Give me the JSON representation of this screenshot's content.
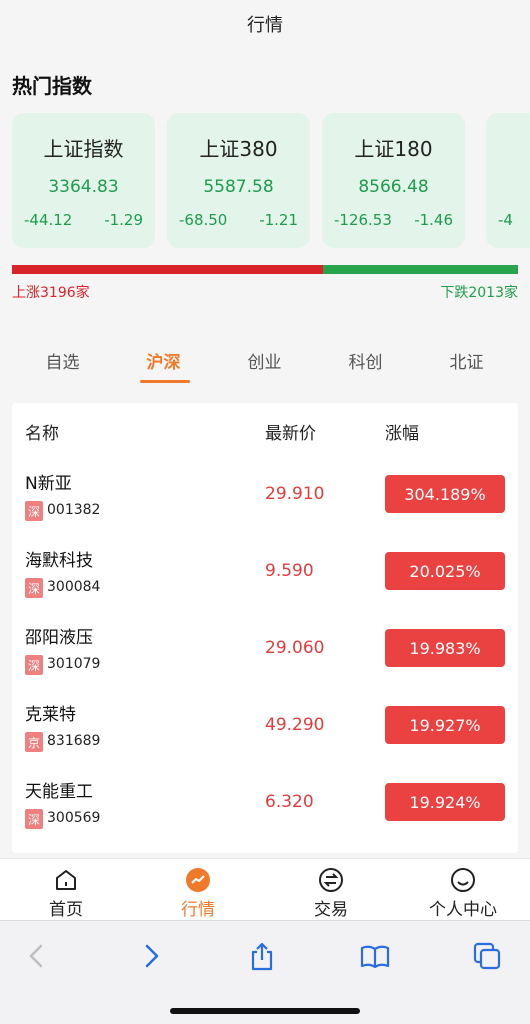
{
  "header": {
    "title": "行情"
  },
  "hot_indices": {
    "title": "热门指数",
    "items": [
      {
        "name": "上证指数",
        "price": "3364.83",
        "change": "-44.12",
        "change_pct": "-1.29"
      },
      {
        "name": "上证380",
        "price": "5587.58",
        "change": "-68.50",
        "change_pct": "-1.21"
      },
      {
        "name": "上证180",
        "price": "8566.48",
        "change": "-126.53",
        "change_pct": "-1.46"
      },
      {
        "name": "",
        "price": "",
        "change": "-4",
        "change_pct": ""
      }
    ]
  },
  "breadth": {
    "up_label": "上涨3196家",
    "down_label": "下跌2013家",
    "up_count": 3196,
    "down_count": 2013,
    "up_color": "#d9232a",
    "down_color": "#27a44c"
  },
  "market_tabs": {
    "items": [
      "自选",
      "沪深",
      "创业",
      "科创",
      "北证"
    ],
    "active": "沪深"
  },
  "table": {
    "headers": {
      "name": "名称",
      "last": "最新价",
      "pct": "涨幅"
    },
    "rows": [
      {
        "name": "N新亚",
        "market": "深",
        "code": "001382",
        "last": "29.910",
        "pct": "304.189%"
      },
      {
        "name": "海默科技",
        "market": "深",
        "code": "300084",
        "last": "9.590",
        "pct": "20.025%"
      },
      {
        "name": "邵阳液压",
        "market": "深",
        "code": "301079",
        "last": "29.060",
        "pct": "19.983%"
      },
      {
        "name": "克莱特",
        "market": "京",
        "code": "831689",
        "last": "49.290",
        "pct": "19.927%"
      },
      {
        "name": "天能重工",
        "market": "深",
        "code": "300569",
        "last": "6.320",
        "pct": "19.924%"
      }
    ]
  },
  "tabbar": {
    "items": [
      {
        "label": "首页",
        "icon": "home-icon"
      },
      {
        "label": "行情",
        "icon": "market-chart-icon"
      },
      {
        "label": "交易",
        "icon": "exchange-icon"
      },
      {
        "label": "个人中心",
        "icon": "smiley-icon"
      }
    ],
    "active": "行情",
    "accent": "#f07a2c"
  },
  "browser": {
    "icons": [
      "back-arrow-icon",
      "forward-arrow-icon",
      "share-icon",
      "bookmarks-icon",
      "tabs-icon"
    ]
  },
  "colors": {
    "rise": "#e43c3c",
    "fall": "#1e9c4d",
    "card_bg": "#e3f4ea"
  }
}
